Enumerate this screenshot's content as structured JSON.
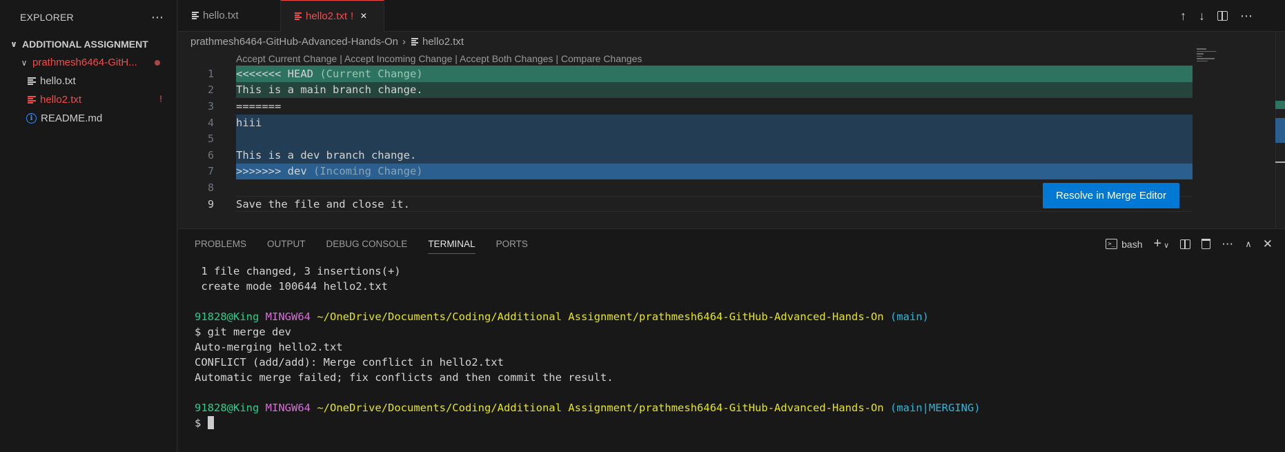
{
  "sidebar": {
    "title": "EXPLORER",
    "more_icon": "ellipsis-icon",
    "section": "ADDITIONAL ASSIGNMENT",
    "folder": "prathmesh6464-GitH...",
    "files": [
      {
        "name": "hello.txt",
        "icon": "file-lines-icon"
      },
      {
        "name": "hello2.txt",
        "icon": "file-lines-icon",
        "badge": "!"
      },
      {
        "name": "README.md",
        "icon": "info-icon"
      }
    ]
  },
  "editor": {
    "tabs": [
      {
        "label": "hello.txt"
      },
      {
        "label": "hello2.txt",
        "badge": "!",
        "close": "×"
      }
    ],
    "breadcrumb": {
      "folder": "prathmesh6464-GitHub-Advanced-Hands-On",
      "sep": "›",
      "file": "hello2.txt"
    },
    "codelens": "Accept Current Change | Accept Incoming Change | Accept Both Changes | Compare Changes",
    "lines": [
      {
        "n": "1",
        "text": "<<<<<<< HEAD",
        "hint": " (Current Change)"
      },
      {
        "n": "2",
        "text": "This is a main branch change."
      },
      {
        "n": "3",
        "text": "======="
      },
      {
        "n": "4",
        "text": "hiii"
      },
      {
        "n": "5",
        "text": ""
      },
      {
        "n": "6",
        "text": "This is a dev branch change."
      },
      {
        "n": "7",
        "text": ">>>>>>> dev",
        "hint": " (Incoming Change)"
      },
      {
        "n": "8",
        "text": ""
      },
      {
        "n": "9",
        "text": "Save the file and close it."
      }
    ],
    "resolve_button": "Resolve in Merge Editor"
  },
  "panel": {
    "tabs": [
      "PROBLEMS",
      "OUTPUT",
      "DEBUG CONSOLE",
      "TERMINAL",
      "PORTS"
    ],
    "active_tab": "TERMINAL",
    "shell": "bash",
    "terminal": {
      "l1": " 1 file changed, 3 insertions(+)",
      "l2": " create mode 100644 hello2.txt",
      "user": "91828@King",
      "sys": "MINGW64",
      "path": "~/OneDrive/Documents/Coding/Additional Assignment/prathmesh6464-GitHub-Advanced-Hands-On",
      "branch1": "(main)",
      "cmd": "$ git merge dev",
      "o1": "Auto-merging hello2.txt",
      "o2": "CONFLICT (add/add): Merge conflict in hello2.txt",
      "o3": "Automatic merge failed; fix conflicts and then commit the result.",
      "branch2": "(main|MERGING)",
      "prompt": "$ "
    }
  }
}
